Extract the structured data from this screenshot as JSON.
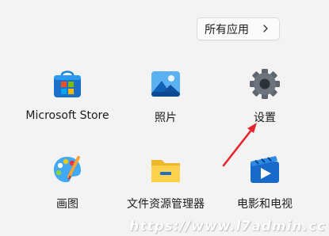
{
  "all_apps": {
    "label": "所有应用"
  },
  "apps": [
    {
      "label": "Microsoft Store",
      "icon": "microsoft-store-icon"
    },
    {
      "label": "照片",
      "icon": "photos-icon"
    },
    {
      "label": "设置",
      "icon": "settings-gear-icon"
    },
    {
      "label": "画图",
      "icon": "paint-palette-icon"
    },
    {
      "label": "文件资源管理器",
      "icon": "file-explorer-folder-icon"
    },
    {
      "label": "电影和电视",
      "icon": "movies-tv-icon"
    }
  ],
  "annotation": {
    "color": "#e5262e"
  },
  "watermark": {
    "text": "https://www.l7admin.cc"
  }
}
